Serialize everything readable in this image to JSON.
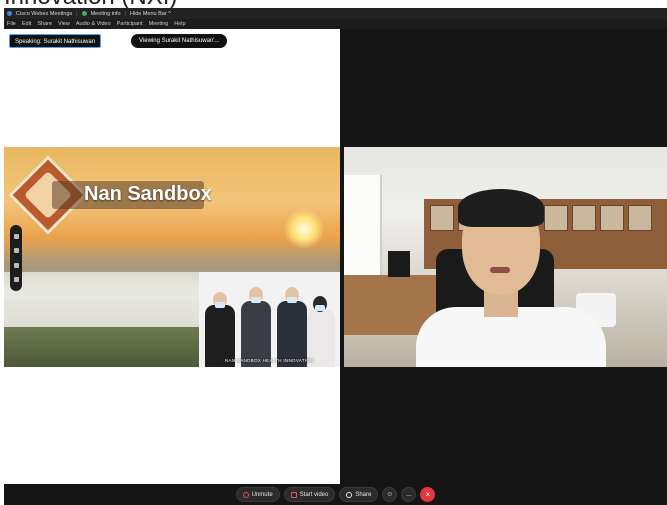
{
  "caption": {
    "text": "Innovation (NXI)"
  },
  "titlebar": {
    "app": "Cisco Webex Meetings",
    "meeting_info": "Meeting info",
    "hide_menu": "Hide Menu Bar ^"
  },
  "menubar": {
    "items": [
      "File",
      "Edit",
      "Share",
      "View",
      "Audio & Video",
      "Participant",
      "Meeting",
      "Help"
    ]
  },
  "share": {
    "speaking_badge": "Speaking: Surakit Nathisuwan",
    "viewing_badge": "Viewing Surakit Nathisuwan'..."
  },
  "slide": {
    "title": "Nan Sandbox",
    "photo_caption": "NAN SANDBOX HEALTH INNOVATION"
  },
  "toolbar": {
    "unmute": "Unmute",
    "start_video": "Start video",
    "share": "Share",
    "more_label": "...",
    "end_label": "×"
  },
  "colors": {
    "accent": "#4da3ff",
    "end_call": "#e0383e",
    "muted_icon": "#d35454",
    "window_bg": "#151515"
  },
  "icons": {
    "app": "webex-logo-icon",
    "meeting_info": "info-icon",
    "unmute": "microphone-muted-icon",
    "start_video": "video-off-icon",
    "share": "share-icon",
    "reactions": "emoji-icon",
    "more": "more-options-icon",
    "end": "end-call-icon"
  }
}
